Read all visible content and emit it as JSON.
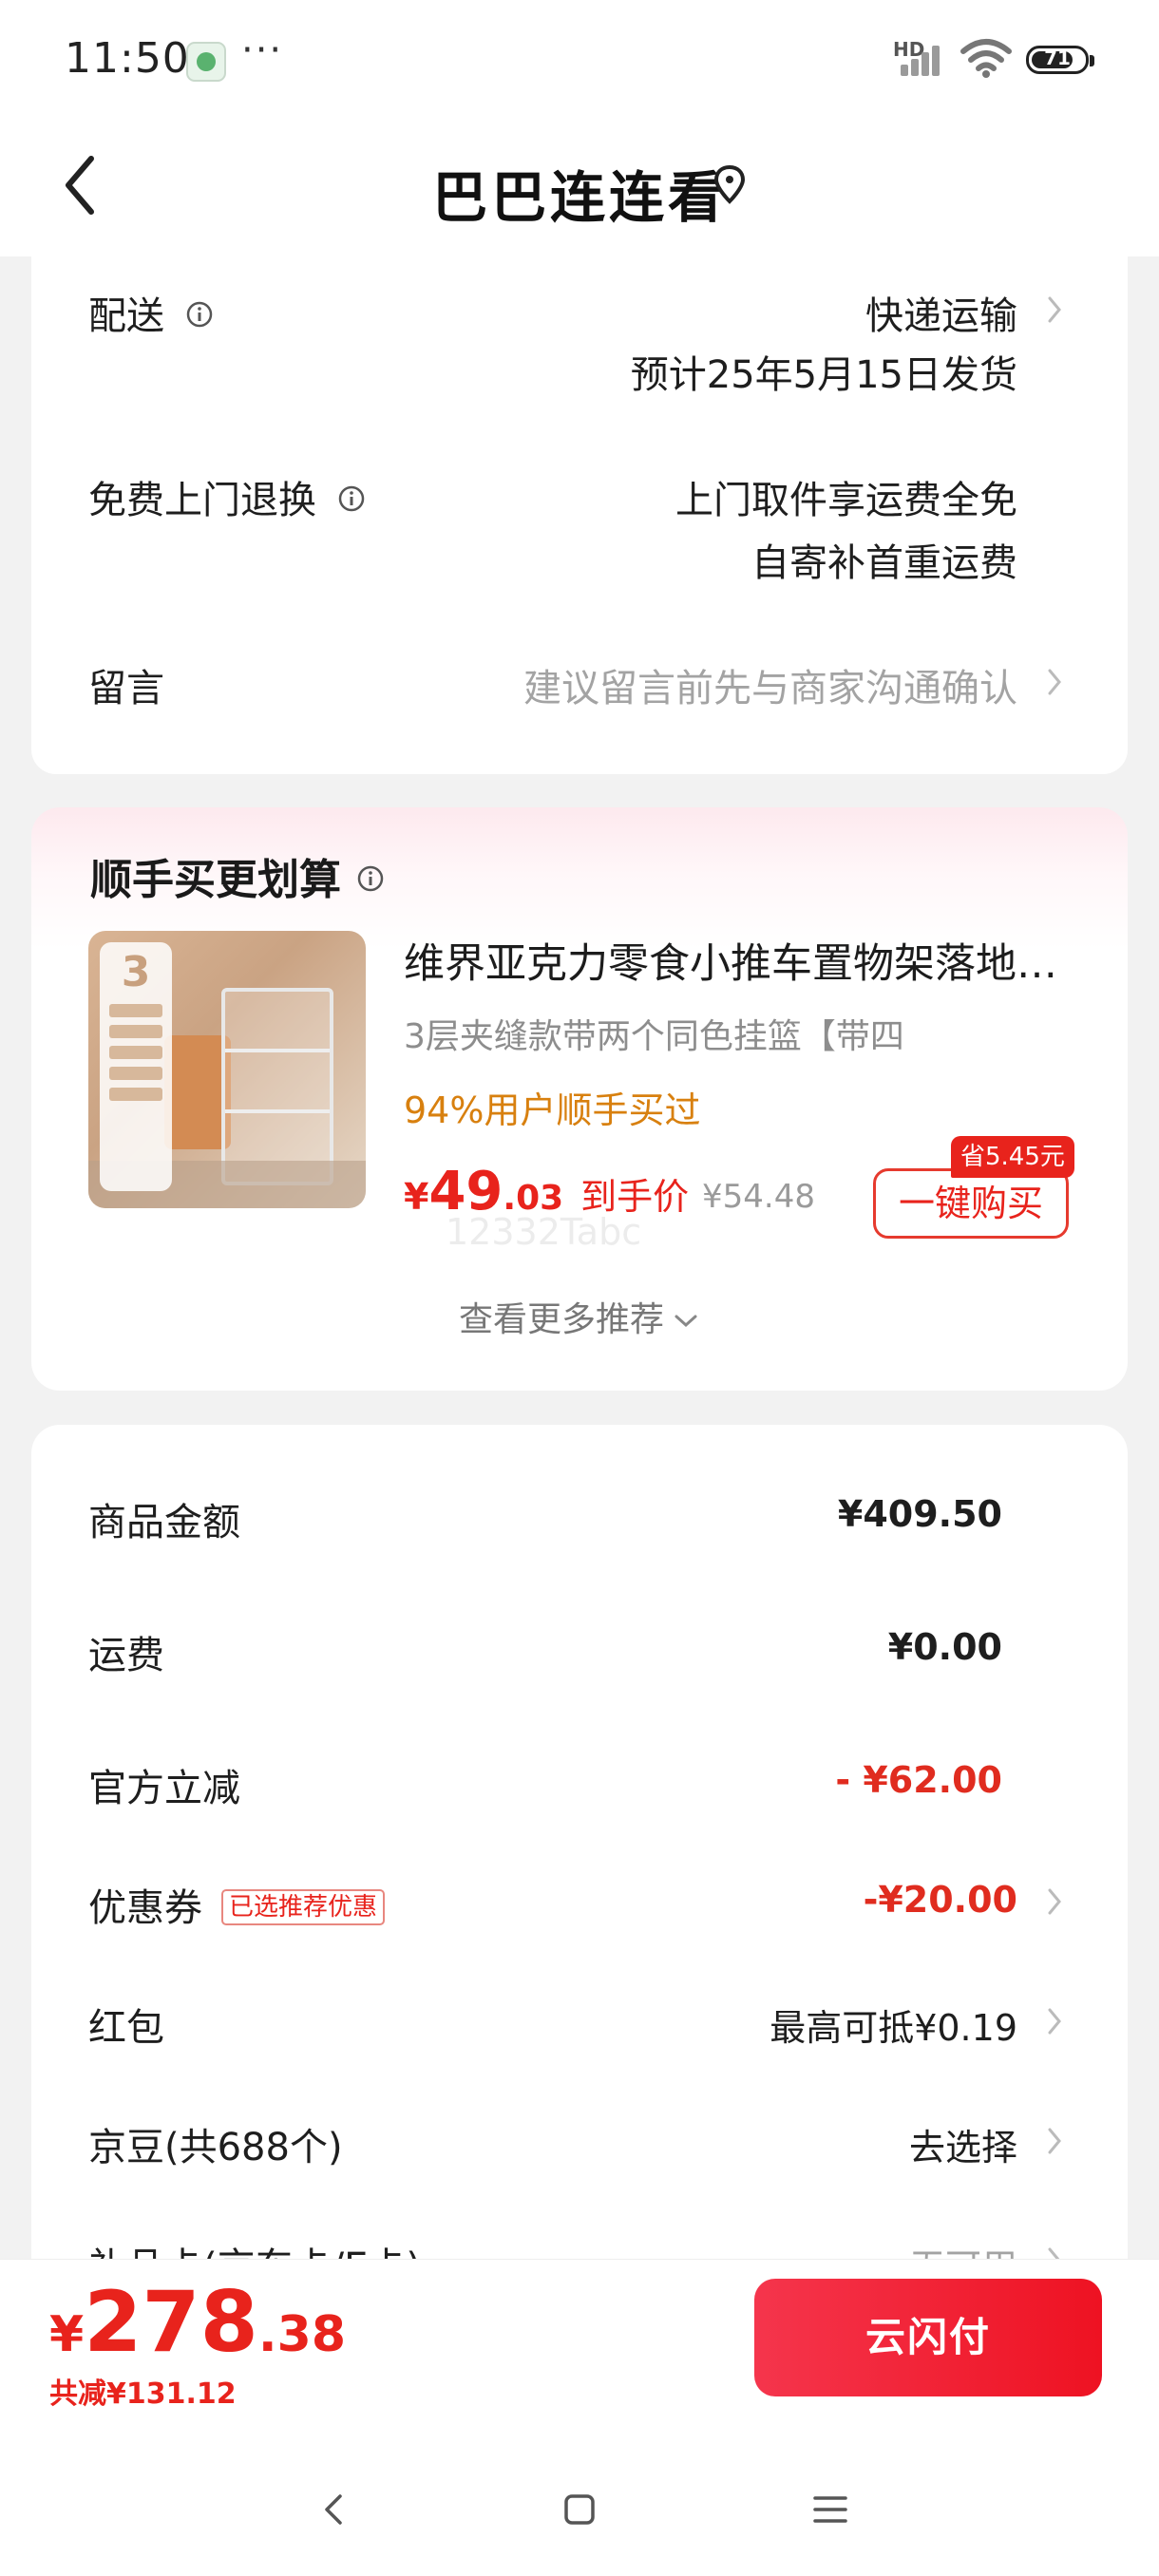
{
  "status_bar": {
    "time": "11:50",
    "more": "···",
    "network_type": "HD",
    "battery_level": "71"
  },
  "header": {
    "title": "巴巴连连看",
    "back_icon": "chevron-left-icon",
    "location_icon": "location-pin-icon"
  },
  "delivery": {
    "shipping_label": "配送",
    "shipping_method": "快递运输",
    "shipping_eta": "预计25年5月15日发货",
    "return_label": "免费上门退换",
    "return_line1": "上门取件享运费全免",
    "return_line2": "自寄补首重运费",
    "message_label": "留言",
    "message_placeholder": "建议留言前先与商家沟通确认"
  },
  "recommend": {
    "title": "顺手买更划算",
    "product": {
      "name": "维界亚克力零食小推车置物架落地多层厨房收纳架",
      "spec": "3层夹缝款带两个同色挂篮【带四",
      "stat": "94%用户顺手买过",
      "price_symbol": "¥",
      "price_int": "49",
      "price_dec": ".03",
      "price_tail": "到手价",
      "original_price": "¥54.48",
      "save_tag": "省5.45元",
      "buy_label": "一键购买",
      "image_badge": "3"
    },
    "watermark": "12332Tabc",
    "more_label": "查看更多推荐"
  },
  "fees": {
    "goods_label": "商品金额",
    "goods_value": "¥409.50",
    "freight_label": "运费",
    "freight_value": "¥0.00",
    "discount_label": "官方立减",
    "discount_value": "- ¥62.00",
    "coupon_label": "优惠券",
    "coupon_badge": "已选推荐优惠",
    "coupon_value": "-¥20.00",
    "redpacket_label": "红包",
    "redpacket_value": "最高可抵¥0.19",
    "beans_label": "京豆(共688个)",
    "beans_value": "去选择",
    "card_label": "礼品卡(京东卡/E卡)",
    "card_value": "无可用"
  },
  "pay_bar": {
    "currency": "¥",
    "total_int": "278",
    "total_dec": ".38",
    "total_save": "共减¥131.12",
    "pay_button": "云闪付"
  },
  "colors": {
    "accent_red": "#e8231c",
    "orange": "#d8800f",
    "background": "#f2f2f2"
  }
}
